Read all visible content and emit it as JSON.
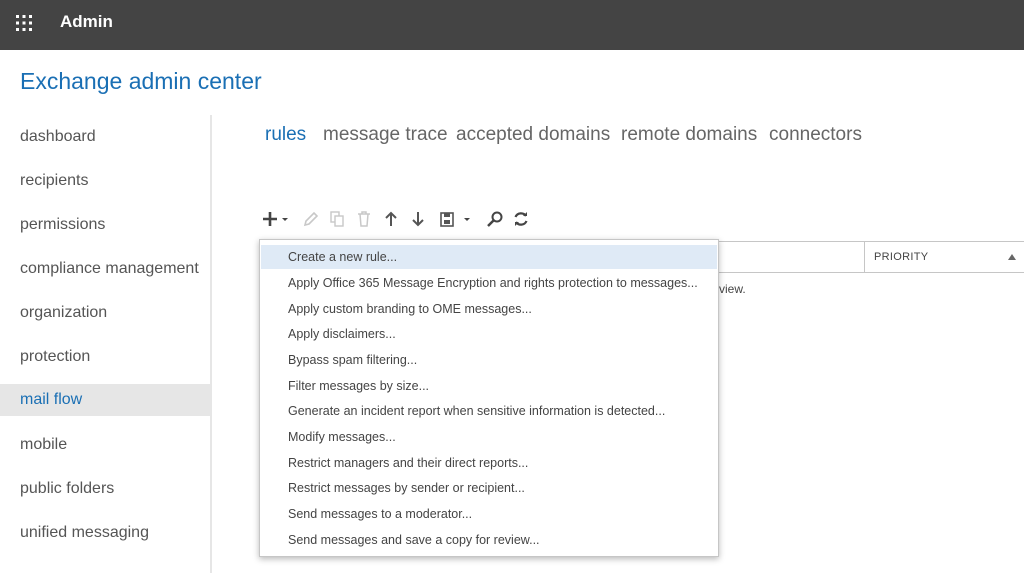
{
  "topbar": {
    "title": "Admin",
    "waffle_icon": "app-launcher-icon"
  },
  "app_title": "Exchange admin center",
  "sidebar": {
    "items": [
      {
        "label": "dashboard",
        "active": false
      },
      {
        "label": "recipients",
        "active": false
      },
      {
        "label": "permissions",
        "active": false
      },
      {
        "label": "compliance management",
        "active": false
      },
      {
        "label": "organization",
        "active": false
      },
      {
        "label": "protection",
        "active": false
      },
      {
        "label": "mail flow",
        "active": true
      },
      {
        "label": "mobile",
        "active": false
      },
      {
        "label": "public folders",
        "active": false
      },
      {
        "label": "unified messaging",
        "active": false
      }
    ]
  },
  "tabs": [
    {
      "label": "rules",
      "active": true
    },
    {
      "label": "message trace",
      "active": false
    },
    {
      "label": "accepted domains",
      "active": false
    },
    {
      "label": "remote domains",
      "active": false
    },
    {
      "label": "connectors",
      "active": false
    }
  ],
  "toolbar": {
    "buttons": [
      {
        "icon": "plus-icon",
        "enabled": true
      },
      {
        "icon": "edit-pencil-icon",
        "enabled": false
      },
      {
        "icon": "copy-icon",
        "enabled": false
      },
      {
        "icon": "delete-icon",
        "enabled": false
      },
      {
        "icon": "arrow-up-icon",
        "enabled": true
      },
      {
        "icon": "arrow-down-icon",
        "enabled": true
      },
      {
        "icon": "save-icon",
        "enabled": true
      },
      {
        "icon": "search-icon",
        "enabled": true
      },
      {
        "icon": "refresh-icon",
        "enabled": true
      }
    ]
  },
  "grid": {
    "priority_header": "PRIORITY",
    "partial_text": "view."
  },
  "menu": {
    "items": [
      "Create a new rule...",
      "Apply Office 365 Message Encryption and rights protection to messages...",
      "Apply custom branding to OME messages...",
      "Apply disclaimers...",
      "Bypass spam filtering...",
      "Filter messages by size...",
      "Generate an incident report when sensitive information is detected...",
      "Modify messages...",
      "Restrict managers and their direct reports...",
      "Restrict messages by sender or recipient...",
      "Send messages to a moderator...",
      "Send messages and save a copy for review..."
    ],
    "highlighted_index": 0
  },
  "colors": {
    "accent": "#1a6fb4",
    "topbar": "#444444",
    "menu_highlight": "#dfeaf6",
    "sidebar_active": "#e6e6e6"
  }
}
